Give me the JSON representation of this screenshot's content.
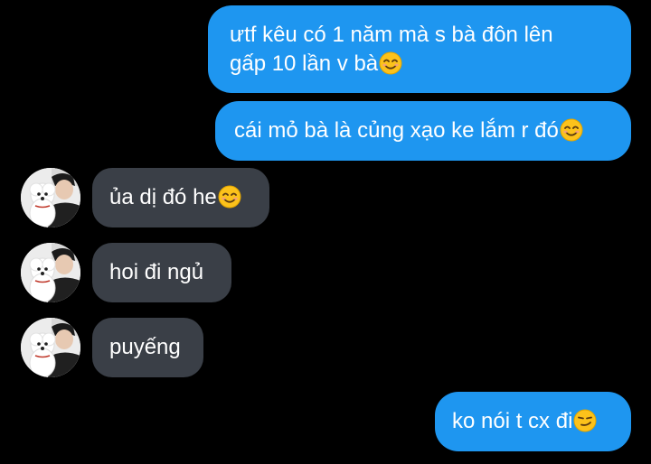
{
  "colors": {
    "background": "#000000",
    "sent_bubble": "#1e96f0",
    "received_bubble": "#3a3f47",
    "text": "#ffffff"
  },
  "messages": [
    {
      "direction": "sent",
      "text": "ưtf kêu có 1 năm mà s bà đôn lên\ngấp 10 lần v bà",
      "emoji": "smiling-face-with-smiling-eyes-icon"
    },
    {
      "direction": "sent",
      "text": "cái mỏ bà là củng xạo ke lắm r đó",
      "emoji": "smiling-face-with-smiling-eyes-icon"
    },
    {
      "direction": "received",
      "text": "ủa dị đó he",
      "emoji": "smiling-face-with-smiling-eyes-icon"
    },
    {
      "direction": "received",
      "text": "hoi đi ngủ",
      "emoji": ""
    },
    {
      "direction": "received",
      "text": "puyếng",
      "emoji": ""
    },
    {
      "direction": "sent",
      "text": "ko nói t cx đi",
      "emoji": "smirking-face-icon"
    }
  ],
  "contact": {
    "avatar_icon": "avatar-person-with-white-dog-icon"
  }
}
